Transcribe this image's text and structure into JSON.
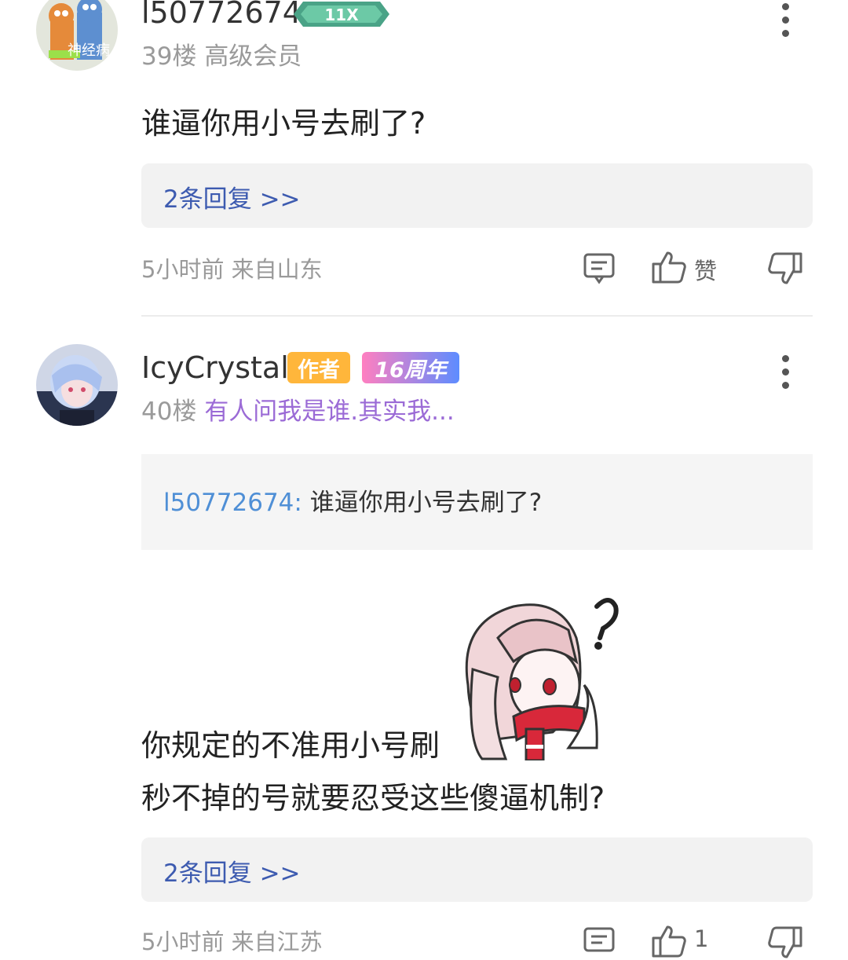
{
  "posts": [
    {
      "username": "l50772674",
      "floor": "39楼",
      "level_title": "高级会员",
      "avatar_text": "神经病",
      "content": "谁逼你用小号去刷了?",
      "reply_link": "2条回复 >>",
      "time": "5小时前",
      "location": "来自山东",
      "like_label": "赞"
    },
    {
      "username": "IcyCrystal",
      "author_tag": "作者",
      "anniversary_tag": "16周年",
      "floor": "40楼",
      "signature": "有人问我是谁.其实我...",
      "quote_user": "l50772674:",
      "quote_text": "谁逼你用小号去刷了?",
      "content_line1": "你规定的不准用小号刷",
      "content_line2": "秒不掉的号就要忍受这些傻逼机制?",
      "reply_link": "2条回复 >>",
      "time": "5小时前",
      "location": "来自江苏",
      "like_count": "1"
    }
  ],
  "icons": {
    "comment": "comment-icon",
    "like": "thumb-up-icon",
    "dislike": "thumb-down-icon",
    "more": "more-vertical-icon"
  },
  "colors": {
    "link": "#3d5bb0",
    "quote_user": "#4f8fd6",
    "signature": "#9b6bd6",
    "author_tag": "#ffb63b"
  }
}
